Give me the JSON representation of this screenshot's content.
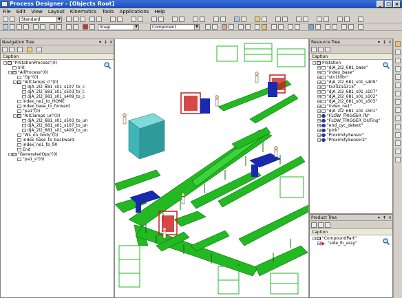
{
  "window": {
    "title": "Process Designer - [Objects Root]"
  },
  "menu": [
    "File",
    "Edit",
    "View",
    "Layout",
    "Kinematics",
    "Tools",
    "Applications",
    "Help"
  ],
  "toolbar": {
    "layout_combo": "Standard",
    "snap_combo": "Snap",
    "component_combo": "Component"
  },
  "navigation_tree": {
    "title": "Navigation Tree",
    "caption": "Caption",
    "rows": [
      {
        "depth": 0,
        "exp": "-",
        "icon": "node",
        "text": "\"PrStationProcess\"(0)"
      },
      {
        "depth": 1,
        "exp": "",
        "icon": "check",
        "text": "Init"
      },
      {
        "depth": 1,
        "exp": "-",
        "icon": "node",
        "text": "\"AllProcess\"(0)"
      },
      {
        "depth": 2,
        "exp": "",
        "icon": "check",
        "text": "\"Op\"(0)"
      },
      {
        "depth": 2,
        "exp": "-",
        "icon": "node",
        "text": "\"AllClamps_cl\"(0)"
      },
      {
        "depth": 3,
        "exp": "",
        "icon": "check",
        "text": "djA_2l2_681_s01_s107_to_c"
      },
      {
        "depth": 3,
        "exp": "",
        "icon": "check",
        "text": "djA_2l2_681_s01_s503_to_c"
      },
      {
        "depth": 3,
        "exp": "",
        "icon": "check",
        "text": "djA_2l2_681_s01_s409_to_c"
      },
      {
        "depth": 2,
        "exp": "",
        "icon": "check",
        "text": "index_ne1_to_HOME"
      },
      {
        "depth": 2,
        "exp": "",
        "icon": "check",
        "text": "index_base_to_forward"
      },
      {
        "depth": 2,
        "exp": "",
        "icon": "check",
        "text": "\"pa1\"(0)"
      },
      {
        "depth": 2,
        "exp": "-",
        "icon": "node",
        "text": "\"AllClamps_un\"(0)"
      },
      {
        "depth": 3,
        "exp": "",
        "icon": "check",
        "text": "djA_2l2_681_s01_s503_to_un"
      },
      {
        "depth": 3,
        "exp": "",
        "icon": "check",
        "text": "djA_2l2_681_s01_s107_to_un"
      },
      {
        "depth": 3,
        "exp": "",
        "icon": "check",
        "text": "djA_2l2_681_s01_s409_to_un"
      },
      {
        "depth": 2,
        "exp": "",
        "icon": "check",
        "text": "\"Ws_on_body\"(0)"
      },
      {
        "depth": 2,
        "exp": "",
        "icon": "check",
        "text": "index_base_to_backward"
      },
      {
        "depth": 2,
        "exp": "",
        "icon": "check",
        "text": "index_ne1_to_90"
      },
      {
        "depth": 2,
        "exp": "",
        "icon": "check",
        "text": "End"
      },
      {
        "depth": 1,
        "exp": "-",
        "icon": "node",
        "text": "\"GeneratedOps\"(0)"
      },
      {
        "depth": 2,
        "exp": "",
        "icon": "check",
        "text": "\"pa1_s\"(0)"
      }
    ]
  },
  "resource_tree": {
    "title": "Resource Tree",
    "caption": "Caption",
    "rows": [
      {
        "depth": 0,
        "exp": "-",
        "icon": "node",
        "text": "PrStation"
      },
      {
        "depth": 1,
        "exp": "+",
        "icon": "check",
        "text": "\"djA_2l2_681_base\""
      },
      {
        "depth": 1,
        "exp": "+",
        "icon": "check",
        "text": "\"index_base\""
      },
      {
        "depth": 1,
        "exp": "+",
        "icon": "check",
        "text": "\"stn1t0br\""
      },
      {
        "depth": 1,
        "exp": "+",
        "icon": "check",
        "text": "\"djA_2l2_681_s01_s409\""
      },
      {
        "depth": 1,
        "exp": "+",
        "icon": "check",
        "text": "\"tx3321a315\""
      },
      {
        "depth": 1,
        "exp": "+",
        "icon": "check",
        "text": "\"djA_2l2_681_s01_s107\""
      },
      {
        "depth": 1,
        "exp": "+",
        "icon": "check",
        "text": "\"djA_2l2_681_s01_s102\""
      },
      {
        "depth": 1,
        "exp": "+",
        "icon": "check",
        "text": "\"djA_2l2_681_s01_s503\""
      },
      {
        "depth": 1,
        "exp": "+",
        "icon": "check",
        "text": "\"index_ne1\""
      },
      {
        "depth": 1,
        "exp": "+",
        "icon": "check",
        "text": "\"djA_2l2_681_s01_s501\""
      },
      {
        "depth": 1,
        "exp": "+",
        "icon": "blue",
        "text": "\"FLOW_TRIGGER_IN\""
      },
      {
        "depth": 1,
        "exp": "+",
        "icon": "blue",
        "text": "\"FLOW_TRIGGER_OUTing\""
      },
      {
        "depth": 1,
        "exp": "+",
        "icon": "blue",
        "text": "\"end_cyc_detect\""
      },
      {
        "depth": 1,
        "exp": "+",
        "icon": "blue",
        "text": "\"pink\""
      },
      {
        "depth": 1,
        "exp": "+",
        "icon": "blue",
        "text": "\"ProximitySensor\""
      },
      {
        "depth": 1,
        "exp": "+",
        "icon": "blue",
        "text": "\"ProximitySensor2\""
      }
    ]
  },
  "product_tree": {
    "title": "Product Tree",
    "caption": "Caption",
    "rows": [
      {
        "depth": 0,
        "exp": "-",
        "icon": "node",
        "text": "\"CompoundPart\""
      },
      {
        "depth": 1,
        "exp": "+",
        "icon": "red",
        "text": "\"side_lh_assy\""
      }
    ]
  },
  "colors": {
    "title_bar": "#1c4fb8",
    "conveyor": "#22b922",
    "fixture_red": "#cc1a1a",
    "fixture_blue": "#1a2ab0",
    "machine_teal": "#3fb5b5"
  }
}
